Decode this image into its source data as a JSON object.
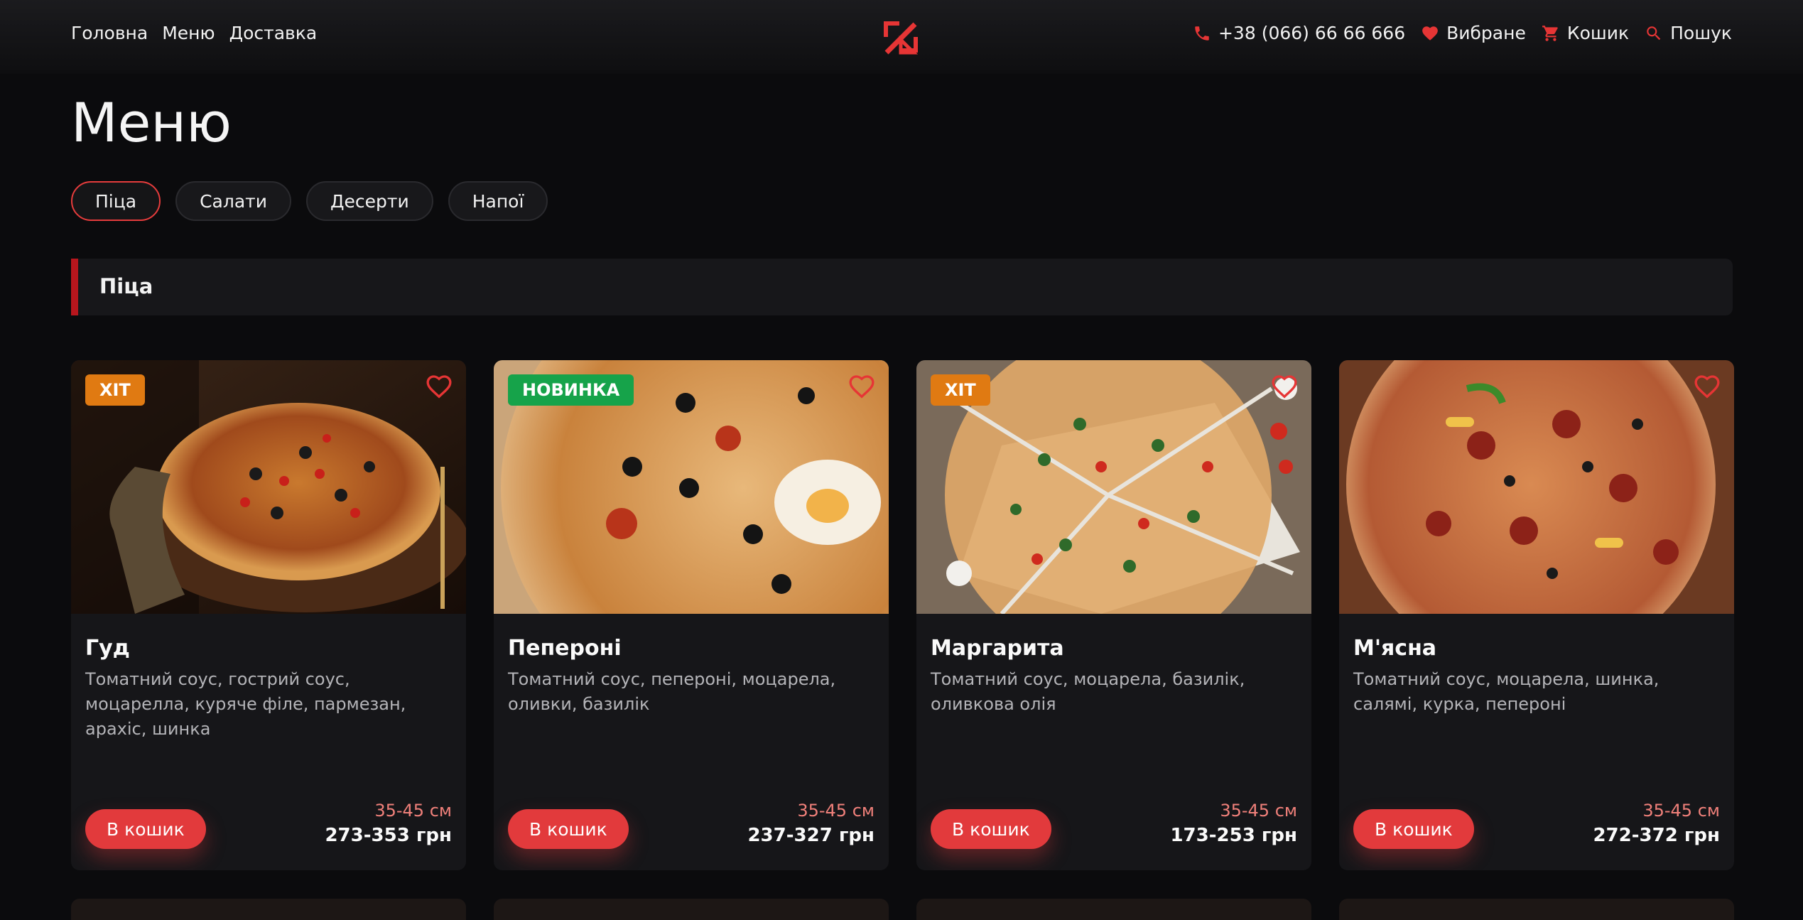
{
  "nav": {
    "left": [
      "Головна",
      "Меню",
      "Доставка"
    ],
    "phone": "+38 (066) 66 66 666",
    "favorites": "Вибране",
    "cart": "Кошик",
    "search": "Пошук"
  },
  "page_title": "Меню",
  "categories": [
    "Піца",
    "Салати",
    "Десерти",
    "Напої"
  ],
  "active_category": "Піца",
  "section_title": "Піца",
  "products": [
    {
      "name": "Гуд",
      "badge": "ХІТ",
      "badge_type": "hit",
      "description": "Томатний соус, гострий соус, моцарелла, куряче філе, пармезан, арахіс, шинка",
      "size": "35-45 см",
      "price": "273-353 грн",
      "button": "В кошик"
    },
    {
      "name": "Пепероні",
      "badge": "НОВИНКА",
      "badge_type": "new",
      "description": "Томатний соус, пепероні, моцарела, оливки, базилік",
      "size": "35-45 см",
      "price": "237-327 грн",
      "button": "В кошик"
    },
    {
      "name": "Маргарита",
      "badge": "ХІТ",
      "badge_type": "hit",
      "description": "Томатний соус, моцарела, базилік, оливкова олія",
      "size": "35-45 см",
      "price": "173-253 грн",
      "button": "В кошик"
    },
    {
      "name": "М'ясна",
      "badge": "",
      "badge_type": "",
      "description": "Томатний соус, моцарела, шинка, салямі, курка, пепероні",
      "size": "35-45 см",
      "price": "272-372 грн",
      "button": "В кошик"
    }
  ],
  "colors": {
    "accent": "#e23a3c",
    "hit": "#e07a12",
    "new": "#16a34a",
    "background": "#0b0b0d"
  },
  "icons": [
    "phone-icon",
    "heart-icon",
    "cart-icon",
    "search-icon",
    "logo-icon"
  ]
}
